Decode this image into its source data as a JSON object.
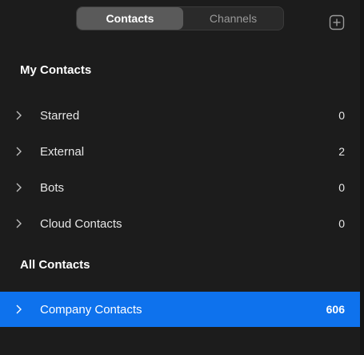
{
  "tabs": {
    "contacts": "Contacts",
    "channels": "Channels"
  },
  "add_icon": "plus-square-icon",
  "sections": {
    "my_contacts": {
      "title": "My Contacts",
      "items": [
        {
          "label": "Starred",
          "count": "0"
        },
        {
          "label": "External",
          "count": "2"
        },
        {
          "label": "Bots",
          "count": "0"
        },
        {
          "label": "Cloud Contacts",
          "count": "0"
        }
      ]
    },
    "all_contacts": {
      "title": "All Contacts",
      "items": [
        {
          "label": "Company Contacts",
          "count": "606"
        }
      ]
    }
  },
  "colors": {
    "background": "#1c1c1c",
    "selected": "#0e72ed",
    "active_tab": "#5a5a5a"
  }
}
